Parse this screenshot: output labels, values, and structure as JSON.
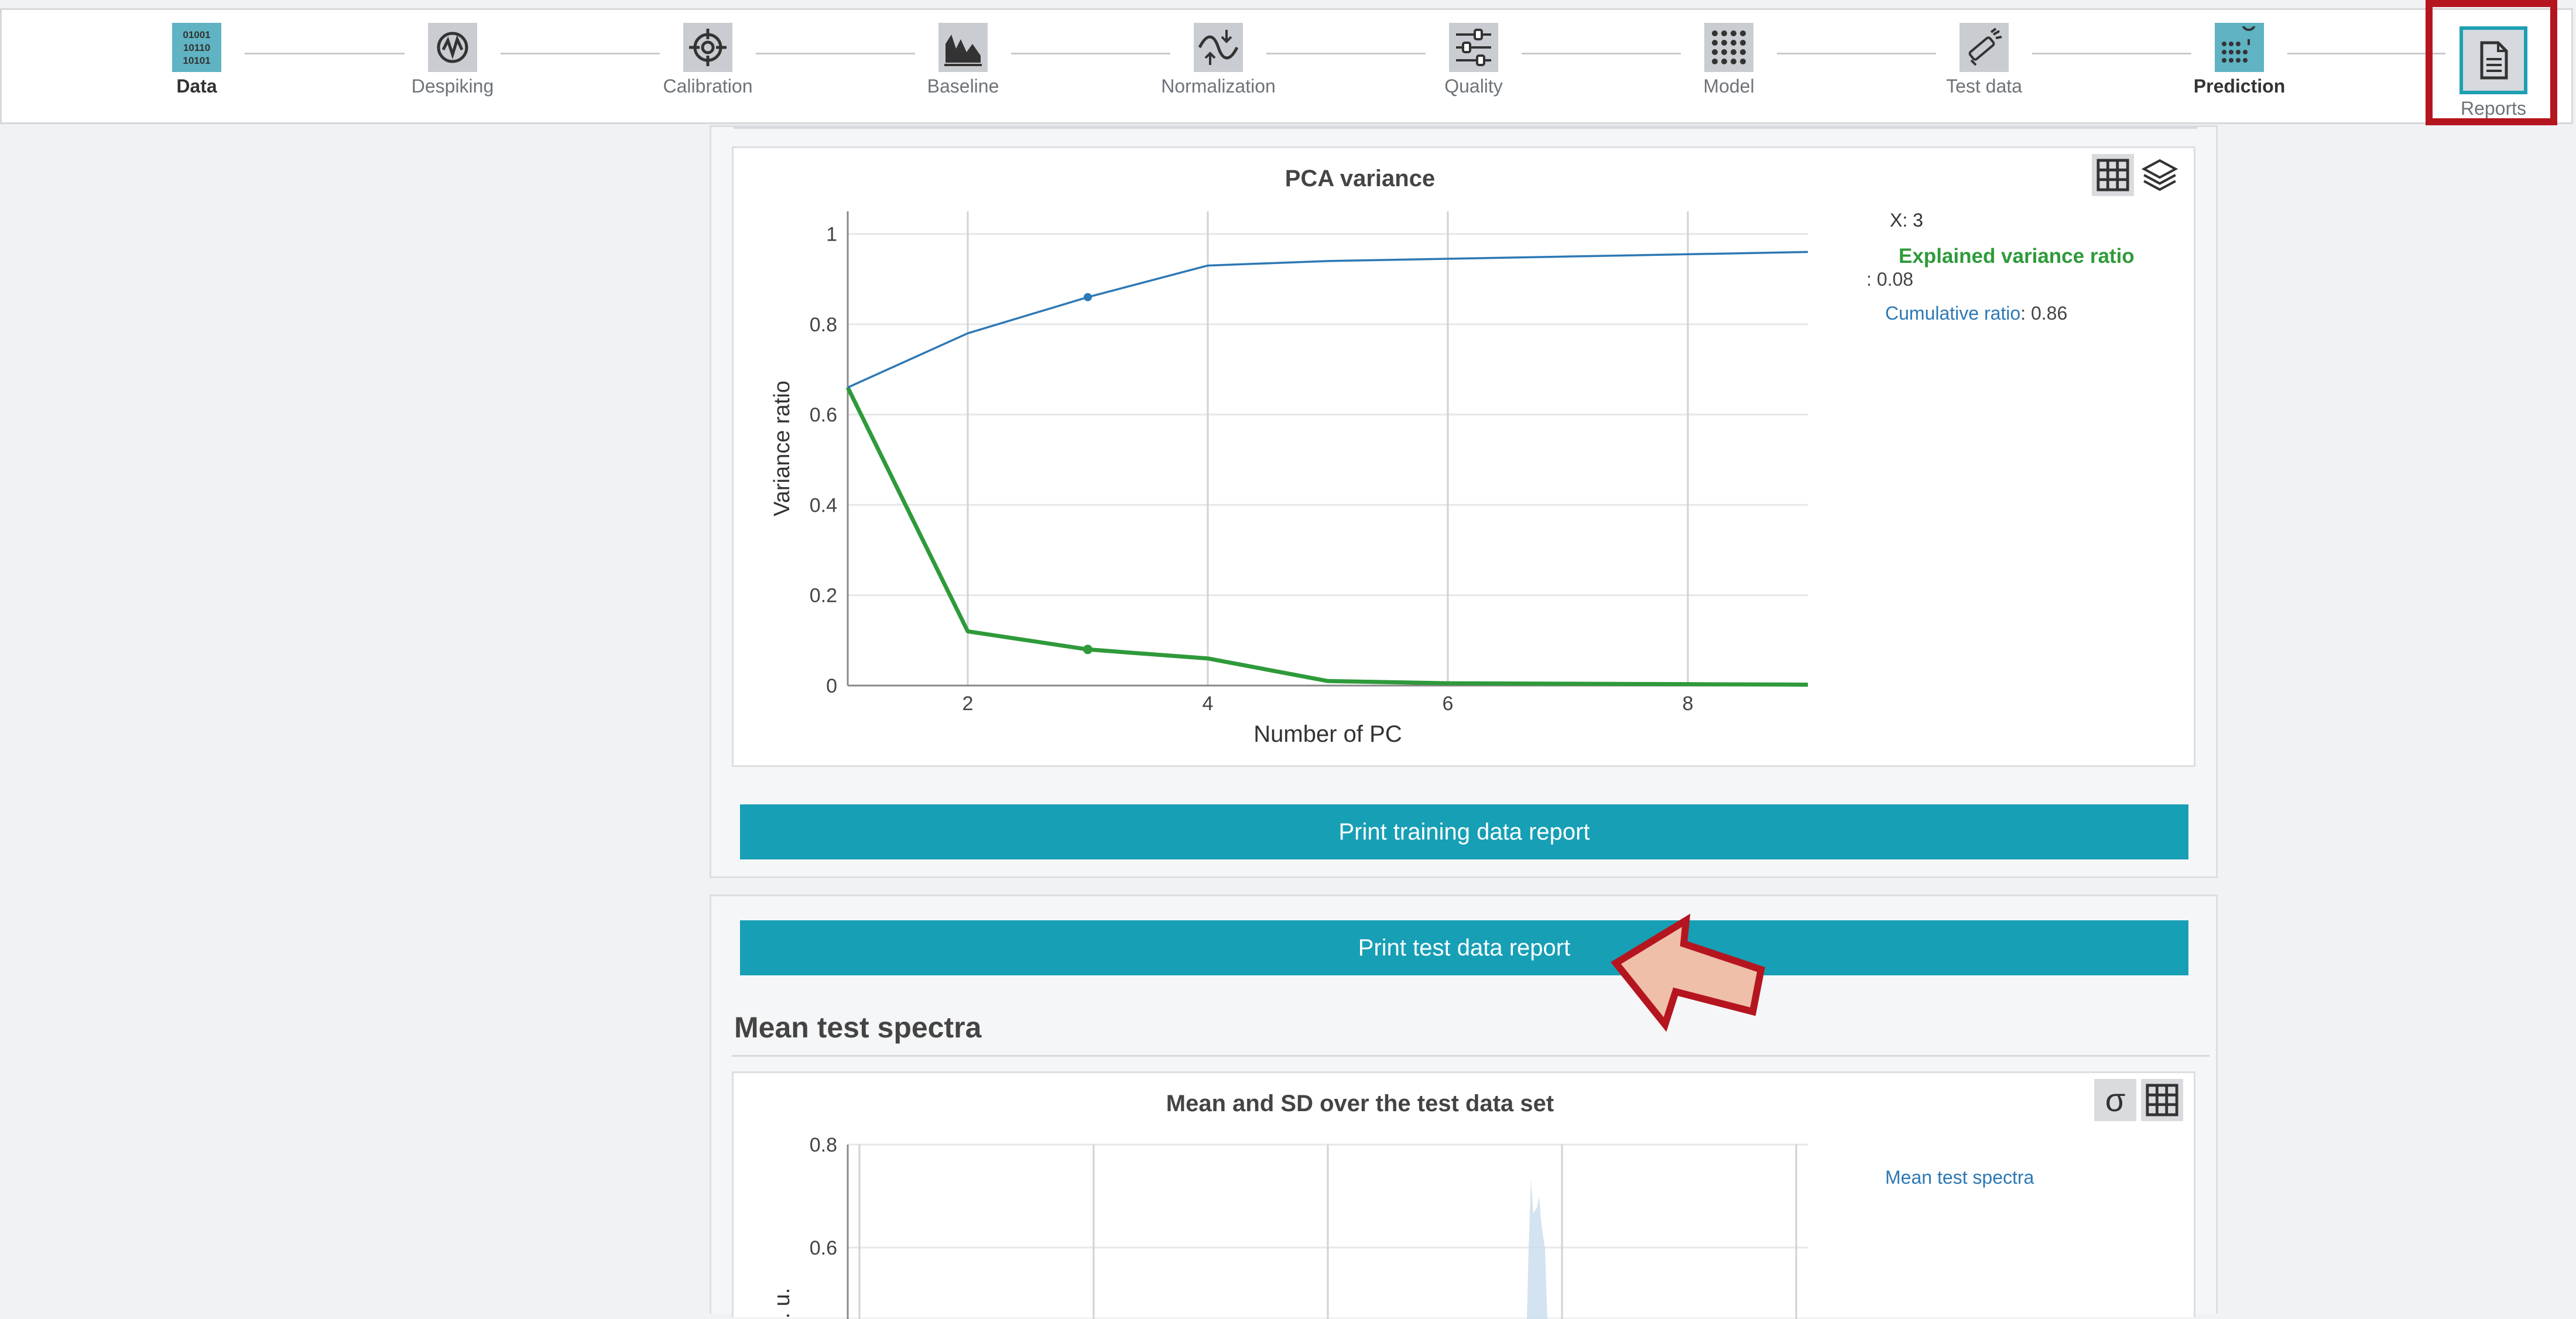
{
  "stepper": {
    "steps": [
      {
        "label": "Data",
        "icon": "binary-data-icon"
      },
      {
        "label": "Despiking",
        "icon": "despiking-icon"
      },
      {
        "label": "Calibration",
        "icon": "crosshair-icon"
      },
      {
        "label": "Baseline",
        "icon": "baseline-icon"
      },
      {
        "label": "Normalization",
        "icon": "normalization-icon"
      },
      {
        "label": "Quality",
        "icon": "sliders-icon"
      },
      {
        "label": "Model",
        "icon": "dot-grid-icon"
      },
      {
        "label": "Test data",
        "icon": "test-tube-icon"
      },
      {
        "label": "Prediction",
        "icon": "prediction-icon"
      },
      {
        "label": "Reports",
        "icon": "document-icon"
      }
    ]
  },
  "pca": {
    "tooltip_x": "X: 3",
    "tooltip_series1": "Explained variance ratio",
    "tooltip_series1_value": ": 0.08",
    "tooltip_series2_label": "Cumulative ratio",
    "tooltip_series2_value": ": 0.86"
  },
  "buttons": {
    "print_training": "Print training data report",
    "print_test": "Print test data report"
  },
  "mean_test": {
    "section_title": "Mean test spectra",
    "legend": "Mean test spectra",
    "sigma_glyph": "σ"
  },
  "colors": {
    "accent": "#179fb5",
    "explained": "#2e9a3a",
    "cumulative": "#2d78b5",
    "highlight": "#b5151f"
  },
  "chart_data": [
    {
      "type": "line",
      "title": "PCA variance",
      "xlabel": "Number of PC",
      "ylabel": "Variance ratio",
      "xlim": [
        1,
        9
      ],
      "ylim": [
        0,
        1.05
      ],
      "xticks": [
        2,
        4,
        6,
        8
      ],
      "yticks": [
        0,
        0.2,
        0.4,
        0.6,
        0.8,
        1
      ],
      "x": [
        1,
        2,
        3,
        4,
        5,
        6,
        7,
        8,
        9
      ],
      "series": [
        {
          "name": "Explained variance ratio",
          "values": [
            0.66,
            0.12,
            0.08,
            0.06,
            0.01,
            0.005,
            0.004,
            0.003,
            0.002
          ]
        },
        {
          "name": "Cumulative ratio",
          "values": [
            0.66,
            0.78,
            0.86,
            0.93,
            0.94,
            0.945,
            0.95,
            0.955,
            0.96
          ]
        }
      ],
      "highlight_x": 3
    },
    {
      "type": "area",
      "title": "Mean and SD over the test data set",
      "ylabel": "rb. u.",
      "ylim": [
        0.45,
        0.8
      ],
      "yticks": [
        0.6,
        0.8
      ],
      "series": [
        {
          "name": "Mean test spectra"
        }
      ]
    }
  ]
}
